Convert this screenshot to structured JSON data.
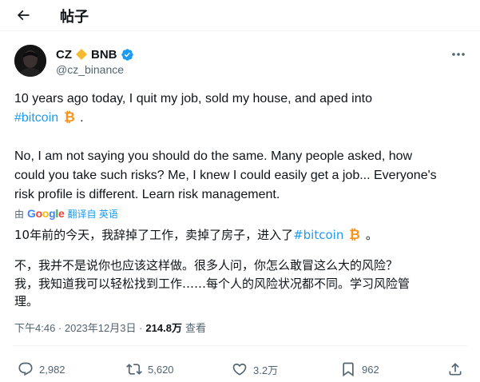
{
  "header": {
    "title": "帖子"
  },
  "author": {
    "name": "CZ",
    "suffix": "BNB",
    "handle": "@cz_binance"
  },
  "tweet": {
    "line1": "10 years ago today, I quit my job, sold my house, and aped into",
    "hashtag": "#bitcoin",
    "line2_tail": ".",
    "line3": "No, I am not saying you should do the same. Many people asked, how",
    "line4": "could you take such risks? Me, I knew I could easily get a job... Everyone's",
    "line5": "risk profile is different. Learn risk management."
  },
  "translation": {
    "prefix": "由",
    "provider": "Google",
    "action": "翻译自 英语",
    "zh_line1_pre": "10年前的今天，我辞掉了工作，卖掉了房子，进入了",
    "zh_hashtag": "#bitcoin",
    "zh_line1_tail": "。",
    "zh_line2": "不，我并不是说你也应该这样做。很多人问，你怎么敢冒这么大的风险？",
    "zh_line3": "我，我知道我可以轻松找到工作……每个人的风险状况都不同。学习风险管",
    "zh_line4": "理。"
  },
  "meta": {
    "time": "下午4:46 · 2023年12月3日 ·",
    "views": "214.8万",
    "views_label": "查看"
  },
  "actions": {
    "replies": "2,982",
    "reposts": "5,620",
    "likes": "3.2万",
    "bookmarks": "962"
  },
  "colors": {
    "accent": "#1d9bf0",
    "verified": "#1d9bf0",
    "bnb": "#f3ba2f",
    "bitcoin": "#f7931a",
    "muted": "#536471"
  }
}
